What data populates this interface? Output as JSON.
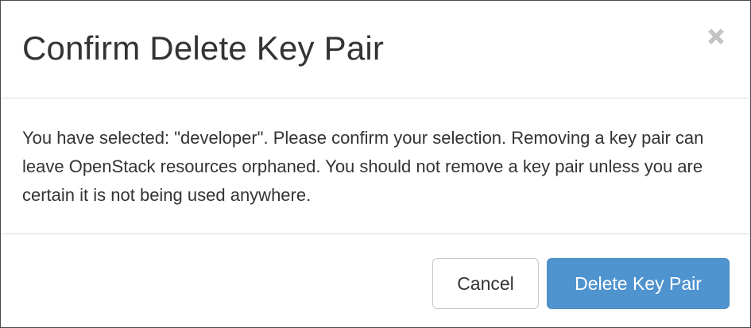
{
  "dialog": {
    "title": "Confirm Delete Key Pair",
    "close_icon": "close-icon",
    "message": "You have selected: \"developer\". Please confirm your selection. Removing a key pair can leave OpenStack resources orphaned. You should not remove a key pair unless you are certain it is not being used anywhere.",
    "buttons": {
      "cancel_label": "Cancel",
      "delete_label": "Delete Key Pair"
    }
  },
  "colors": {
    "primary": "#4f93cf",
    "text": "#333333",
    "divider": "#dcdcdc"
  }
}
